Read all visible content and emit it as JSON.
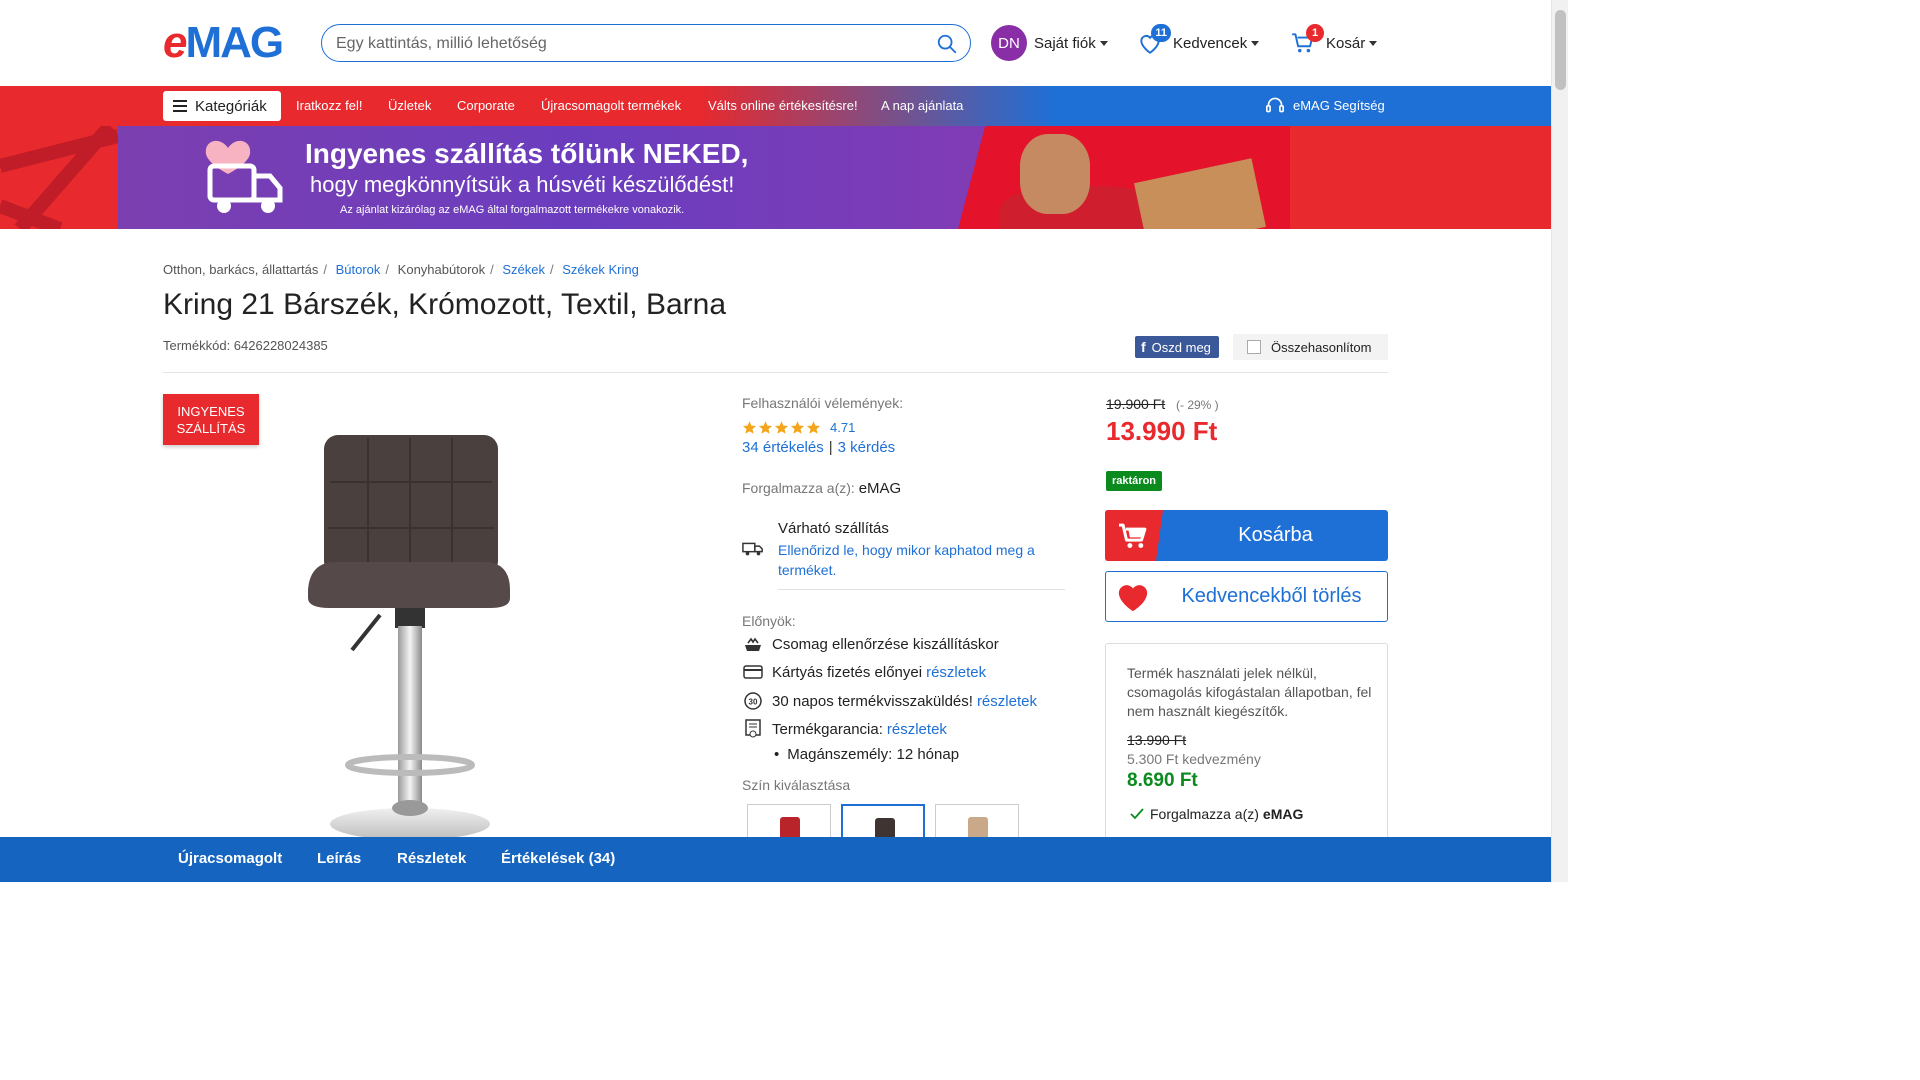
{
  "header": {
    "logo_e": "e",
    "logo_mag": "MAG",
    "search_placeholder": "Egy kattintás, millió lehetőség",
    "account": {
      "initials": "DN",
      "label": "Saját fiók"
    },
    "favorites": {
      "label": "Kedvencek",
      "count": "11"
    },
    "cart": {
      "label": "Kosár",
      "count": "1"
    }
  },
  "nav": {
    "categories": "Kategóriák",
    "links": [
      "Iratkozz fel!",
      "Üzletek",
      "Corporate",
      "Újracsomagolt termékek",
      "Válts online értékesítésre!",
      "A nap ajánlata"
    ],
    "help": "eMAG Segítség"
  },
  "banner": {
    "line1": "Ingyenes szállítás tőlünk NEKED,",
    "line2": "hogy megkönnyítsük a húsvéti készülődést!",
    "line3": "Az ajánlat kizárólag az eMAG által forgalmazott termékekre vonakozik."
  },
  "breadcrumb": [
    "Otthon, barkács, állattartás",
    "Bútorok",
    "Konyhabútorok",
    "Székek",
    "Székek Kring"
  ],
  "product": {
    "title": "Kring 21 Bárszék, Krómozott, Textil, Barna",
    "code": "Termékkód: 6426228024385",
    "share": "Oszd meg",
    "compare": "Összehasonlítom",
    "free_shipping_line1": "INGYENES",
    "free_shipping_line2": "SZÁLLÍTÁS"
  },
  "reviews": {
    "label": "Felhasználói vélemények:",
    "rating": "4.71",
    "stars": 4.71,
    "count_link": "34 értékelés",
    "questions_link": "3 kérdés",
    "separator": "|"
  },
  "seller": {
    "label": "Forgalmazza a(z):",
    "name": "eMAG"
  },
  "shipping": {
    "title": "Várható szállítás",
    "link": "Ellenőrizd le, hogy mikor kaphatod meg a terméket."
  },
  "benefits": {
    "label": "Előnyök:",
    "items": [
      {
        "icon": "package-check-icon",
        "text": "Csomag ellenőrzése kiszállításkor",
        "link": ""
      },
      {
        "icon": "credit-card-icon",
        "text": "Kártyás fizetés előnyei",
        "link": "részletek"
      },
      {
        "icon": "return-30-icon",
        "text": "30 napos termékvisszaküldés!",
        "link": "részletek"
      },
      {
        "icon": "warranty-icon",
        "text": "Termékgarancia:",
        "link": "részletek"
      }
    ],
    "warranty_detail": "Magánszemély: 12 hónap"
  },
  "color_select": {
    "label": "Szín kiválasztása",
    "swatches": [
      {
        "color": "#b8242a",
        "selected": false
      },
      {
        "color": "#3f3432",
        "selected": true
      },
      {
        "color": "#c9a98a",
        "selected": false
      }
    ]
  },
  "pricing": {
    "old_price": "19.900 Ft",
    "discount": "(- 29% )",
    "price": "13.990 Ft",
    "stock": "raktáron",
    "add_to_cart": "Kosárba",
    "remove_favorite": "Kedvencekből törlés"
  },
  "resealed": {
    "description": "Termék használati jelek nélkül, csomagolás kifogástalan állapotban, fel nem használt kiegészítők.",
    "old_price": "13.990 Ft",
    "saving": "5.300 Ft kedvezmény",
    "price": "8.690 Ft",
    "sold_by_label": "Forgalmazza a(z)",
    "sold_by": "eMAG"
  },
  "bottom_tabs": [
    "Újracsomagolt",
    "Leírás",
    "Részletek",
    "Értékelések (34)"
  ],
  "colors": {
    "brand_red": "#e8292d",
    "brand_blue": "#1e70d6",
    "stock_green": "#0b8a1e"
  }
}
